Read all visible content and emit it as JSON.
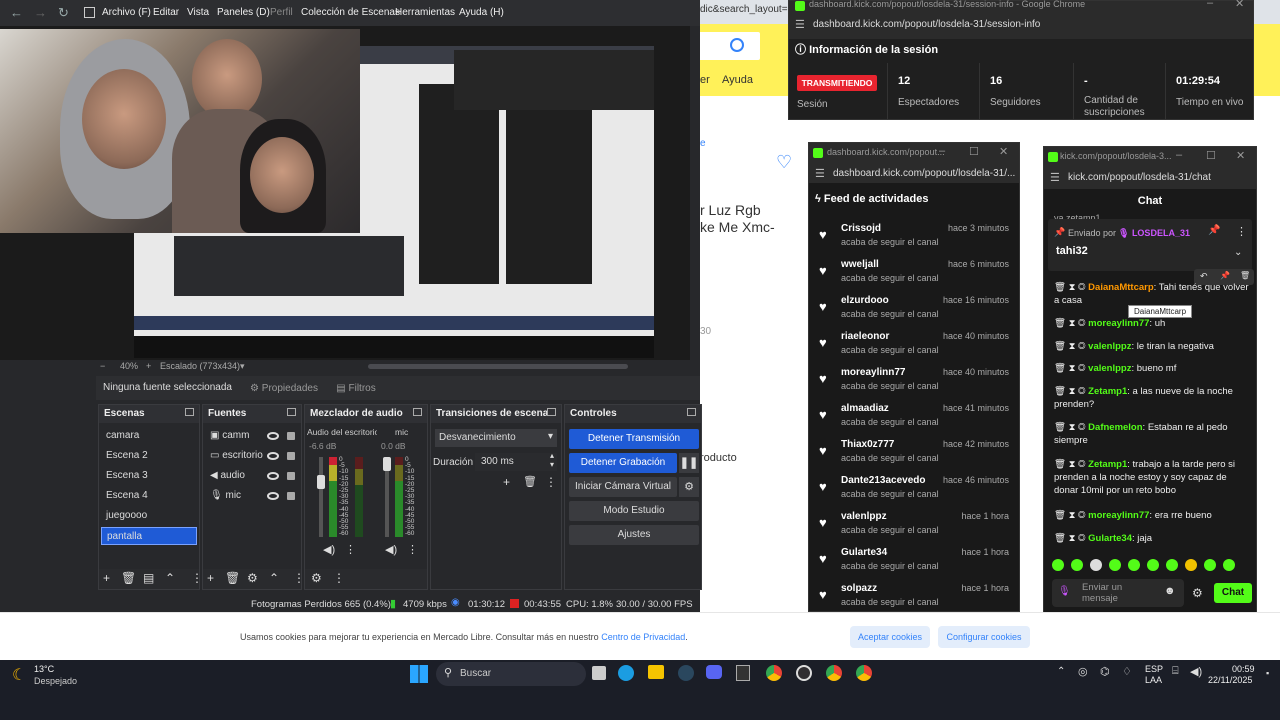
{
  "mercadolibre": {
    "url_fragment": "dic&search_layout=",
    "menu_ayer": "er",
    "menu_ayuda": "Ayuda",
    "product_title": "r Luz Rgb\nke Me Xmc-",
    "link_e": "e",
    "producto": "roducto",
    "small_30": "30",
    "cookie_text": "Usamos cookies para mejorar tu experiencia en Mercado Libre. Consultar más en nuestro",
    "cookie_link": "Centro de Privacidad",
    "cookie_accept": "Aceptar cookies",
    "cookie_config": "Configurar cookies"
  },
  "obs": {
    "menu": [
      "Archivo (F)",
      "Editar",
      "Vista",
      "Paneles (D)",
      "Perfil",
      "Colección de Escenas",
      "Herramientas",
      "Ayuda (H)"
    ],
    "zoom": "40%",
    "scale": "Escalado (773x434)",
    "no_source": "Ninguna fuente seleccionada",
    "properties": "Propiedades",
    "filters": "Filtros",
    "scenes_title": "Escenas",
    "scenes": [
      "camara",
      "Escena 2",
      "Escena 3",
      "Escena 4",
      "juegoooo",
      "pantalla"
    ],
    "selected_scene": "pantalla",
    "sources_title": "Fuentes",
    "sources": [
      {
        "name": "camm",
        "icon": "camera-icon"
      },
      {
        "name": "escritorio",
        "icon": "monitor-icon"
      },
      {
        "name": "audio",
        "icon": "speaker-icon"
      },
      {
        "name": "mic",
        "icon": "microphone-icon"
      }
    ],
    "mixer_title": "Mezclador de audio",
    "mixer_ch1": "Audio del escritorio",
    "mixer_ch1_db": "-6.6 dB",
    "mixer_ch2": "mic",
    "mixer_ch2_db": "0.0 dB",
    "meter_scale": [
      "0",
      "-5",
      "-10",
      "-15",
      "-20",
      "-25",
      "-30",
      "-35",
      "-40",
      "-45",
      "-50",
      "-55",
      "-60"
    ],
    "transitions_title": "Transiciones de escena",
    "transition": "Desvanecimiento",
    "duration_label": "Duración",
    "duration": "300 ms",
    "controls_title": "Controles",
    "btn_stop_stream": "Detener Transmisión",
    "btn_stop_rec": "Detener Grabación",
    "btn_virtual_cam": "Iniciar Cámara Virtual",
    "btn_studio": "Modo Estudio",
    "btn_settings": "Ajustes",
    "status_frames": "Fotogramas Perdidos 665 (0.4%)",
    "status_kbps": "4709 kbps",
    "status_stream_time": "01:30:12",
    "status_rec_time": "00:43:55",
    "status_cpu": "CPU: 1.8%",
    "status_fps": "30.00 / 30.00 FPS"
  },
  "session": {
    "tab_title": "dashboard.kick.com/popout/losdela-31/session-info - Google Chrome",
    "url": "dashboard.kick.com/popout/losdela-31/session-info",
    "header": "Información de la sesión",
    "badge": "TRANSMITIENDO",
    "session_label": "Sesión",
    "viewers_value": "12",
    "viewers_label": "Espectadores",
    "followers_value": "16",
    "followers_label": "Seguidores",
    "subs_value": "-",
    "subs_label": "Cantidad de suscripciones",
    "live_time_value": "01:29:54",
    "live_time_label": "Tiempo en vivo"
  },
  "feed": {
    "tab_title": "dashboard.kick.com/popout...",
    "url": "dashboard.kick.com/popout/losdela-31/...",
    "header": "Feed de actividades",
    "subtitle": "acaba de seguir el canal",
    "items": [
      {
        "name": "Crissojd",
        "time": "hace 3 minutos"
      },
      {
        "name": "wweljall",
        "time": "hace 6 minutos"
      },
      {
        "name": "elzurdooo",
        "time": "hace 16 minutos"
      },
      {
        "name": "riaeleonor",
        "time": "hace 40 minutos"
      },
      {
        "name": "moreaylinn77",
        "time": "hace 40 minutos"
      },
      {
        "name": "almaadiaz",
        "time": "hace 41 minutos"
      },
      {
        "name": "Thiax0z777",
        "time": "hace 42 minutos"
      },
      {
        "name": "Dante213acevedo",
        "time": "hace 46 minutos"
      },
      {
        "name": "valenlppz",
        "time": "hace 1 hora"
      },
      {
        "name": "Gularte34",
        "time": "hace 1 hora"
      },
      {
        "name": "solpazz",
        "time": "hace 1 hora"
      }
    ]
  },
  "chat": {
    "tab_title": "kick.com/popout/losdela-3...",
    "url": "kick.com/popout/losdela-31/chat",
    "header": "Chat",
    "partial_top": "va zetamp1",
    "pinned_by_label": "Enviado por",
    "pinned_by_user": "LOSDELA_31",
    "pinned_text": "tahi32",
    "tooltip": "DaianaMttcarp",
    "messages": [
      {
        "user": "DaianaMttcarp",
        "color": "#ff9800",
        "text": ": Tahi tenés que volver a casa"
      },
      {
        "user": "moreaylinn77",
        "color": "#53fc18",
        "text": ": uh"
      },
      {
        "user": "valenlppz",
        "color": "#53fc18",
        "text": ": le tiran la negativa"
      },
      {
        "user": "valenlppz",
        "color": "#53fc18",
        "text": ": bueno mf"
      },
      {
        "user": "Zetamp1",
        "color": "#53fc18",
        "text": ": a las nueve de la noche prenden?"
      },
      {
        "user": "Dafnemelon",
        "color": "#53fc18",
        "text": ": Estaban re al pedo siempre"
      },
      {
        "user": "Zetamp1",
        "color": "#53fc18",
        "text": ": trabajo a la tarde pero si prenden a la noche estoy y soy capaz de donar 10mil por un reto bobo"
      },
      {
        "user": "moreaylinn77",
        "color": "#53fc18",
        "text": ": era rre bueno"
      },
      {
        "user": "Gularte34",
        "color": "#53fc18",
        "text": ": jaja"
      }
    ],
    "input_placeholder": "Enviar un mensaje",
    "send_button": "Chat"
  },
  "taskbar": {
    "weather_temp": "13°C",
    "weather_desc": "Despejado",
    "search": "Buscar",
    "lang": "ESP",
    "lang2": "LAA",
    "time": "00:59",
    "date": "22/11/2025"
  }
}
